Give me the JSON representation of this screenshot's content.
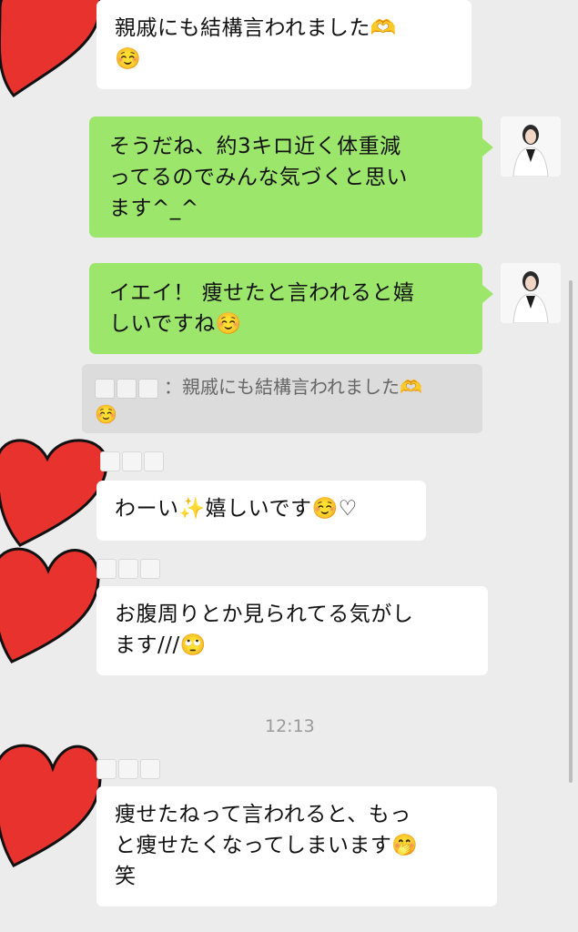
{
  "messages": [
    {
      "id": "m1",
      "text": "親戚にも結構言われました🫶\n☺️"
    },
    {
      "id": "m2",
      "text": "そうだね、約3キロ近く体重減\nってるのでみんな気づくと思い\nます^_^"
    },
    {
      "id": "m3",
      "text": "イエイ！ 痩せたと言われると嬉\nしいですね☺️"
    },
    {
      "id": "m4",
      "text": "わーい✨嬉しいです☺️♡"
    },
    {
      "id": "m5",
      "text": "お腹周りとか見られてる気がし\nます///🙄"
    },
    {
      "id": "m6",
      "text": "痩せたねって言われると、もっ\nと痩せたくなってしまいます🤭\n笑"
    }
  ],
  "quote": {
    "separator": "：",
    "text": "親戚にも結構言われました🫶\n☺️"
  },
  "timestamp": "12:13",
  "colors": {
    "background": "#ececec",
    "incoming_bubble": "#ffffff",
    "outgoing_bubble": "#9ce66b",
    "heart": "#e8322d"
  }
}
